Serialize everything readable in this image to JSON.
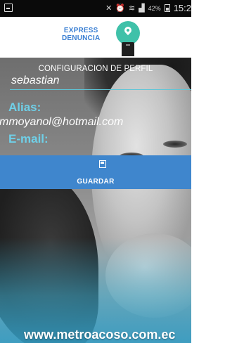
{
  "status_bar": {
    "time": "15:2",
    "battery": "42%"
  },
  "logo": {
    "line1": "EXPRESS",
    "line2": "DENUNCIA"
  },
  "profile": {
    "section_title": "CONFIGURACION DE PERFIL",
    "name_value": "sebastian",
    "alias_label": "Alias:",
    "email_value": "mmoyanol@hotmail.com",
    "email_label": "E-mail:"
  },
  "actions": {
    "save_label": "GUARDAR"
  },
  "footer": {
    "url": "www.metroacoso.com.ec"
  },
  "colors": {
    "accent_blue": "#3f86cd",
    "label_cyan": "#6fd0e8",
    "logo_teal": "#3fc1a9"
  }
}
